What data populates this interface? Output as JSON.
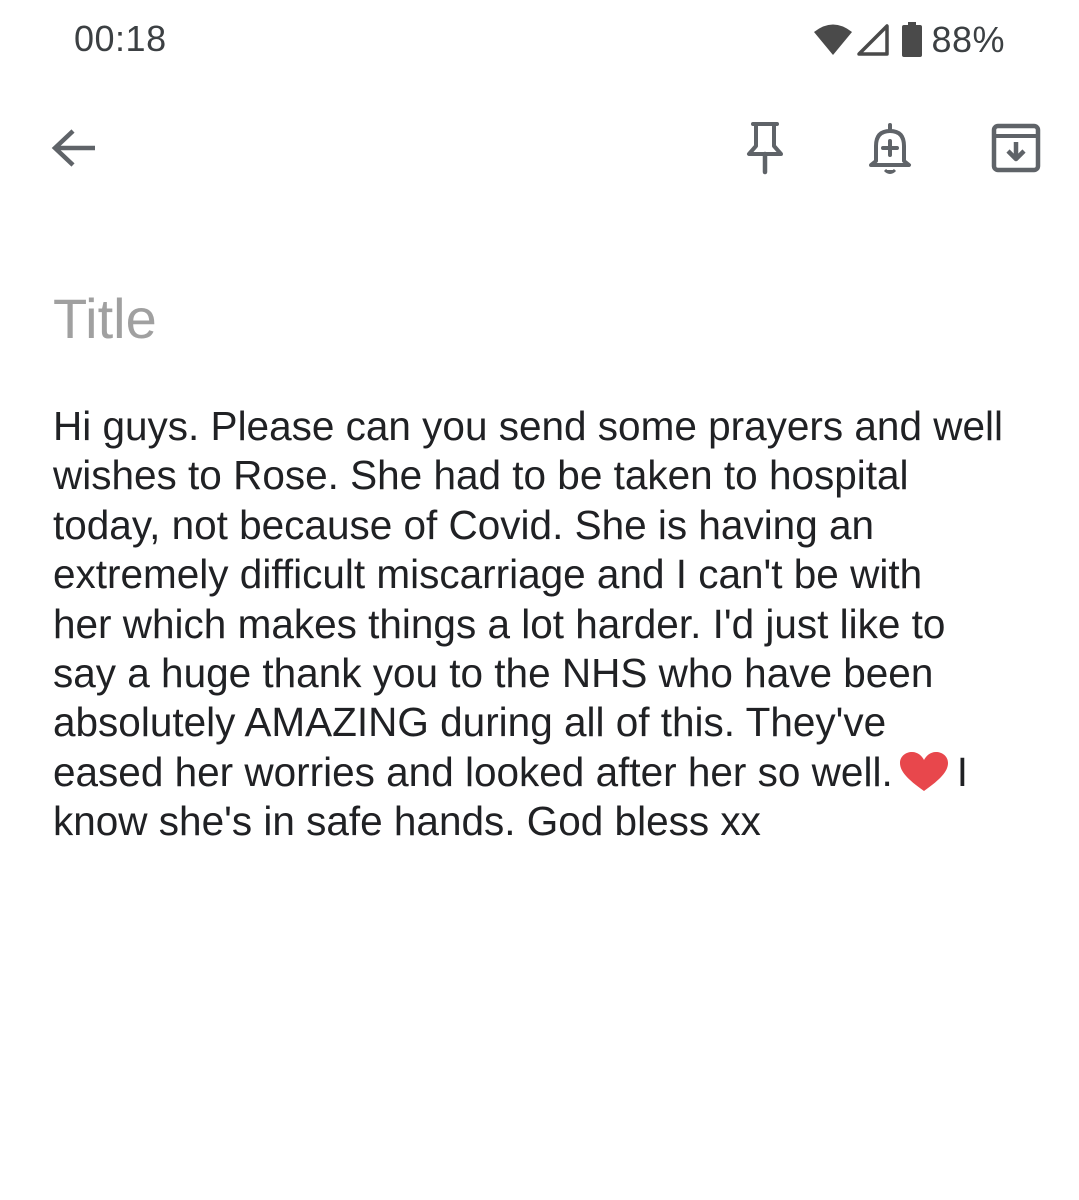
{
  "status_bar": {
    "time": "00:18",
    "battery_percent": "88%",
    "icons": [
      "wifi-icon",
      "cell-signal-icon",
      "battery-icon"
    ]
  },
  "toolbar": {
    "icons": [
      "back-arrow-icon",
      "pin-icon",
      "add-reminder-icon",
      "archive-icon"
    ]
  },
  "note": {
    "title_placeholder": "Title",
    "title_value": "",
    "body_lines": [
      "Hi guys. Please can you send some prayers and well",
      "wishes to Rose. She had to be taken to hospital",
      "today, not because of Covid. She is having an",
      "extremely difficult miscarriage and I can't be with",
      "her which makes things a lot harder. I'd just like to",
      "say a huge thank you to the NHS who have been",
      "absolutely AMAZING during all of this. They've",
      "eased her worries and looked after her so well.",
      "I",
      "know she's in safe hands. God bless xx"
    ],
    "emoji": "red-heart-emoji",
    "heart_color": "#e8474c"
  },
  "colors": {
    "icon": "#5f6368",
    "placeholder": "#a0a0a0",
    "text": "#202124"
  }
}
